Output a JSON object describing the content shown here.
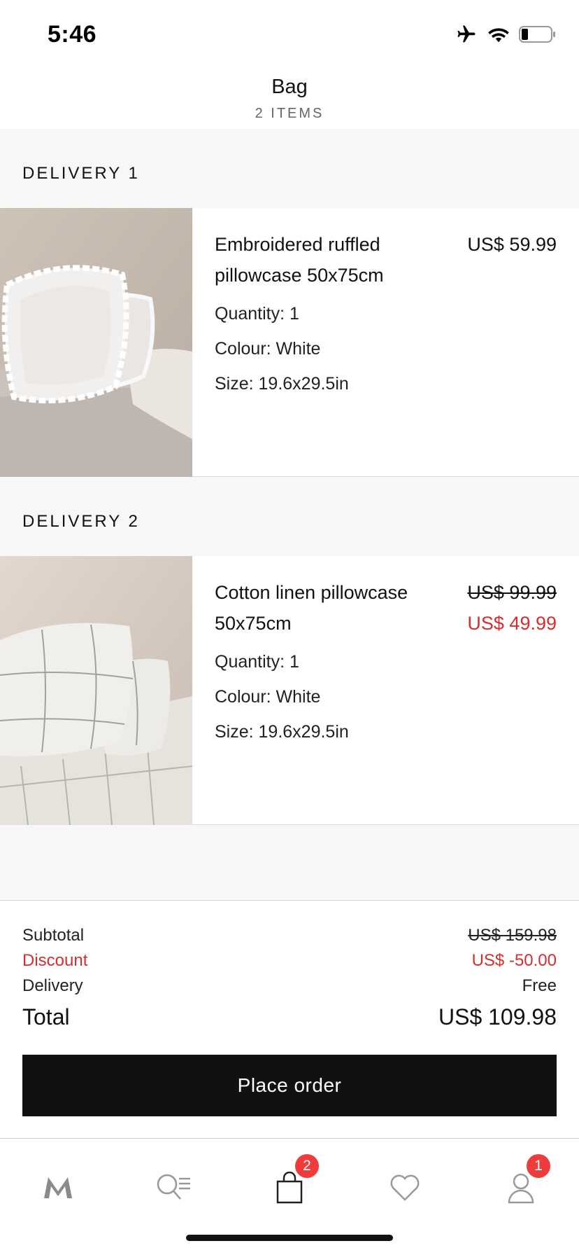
{
  "status": {
    "time": "5:46"
  },
  "header": {
    "title": "Bag",
    "count": "2 ITEMS"
  },
  "deliveries": [
    {
      "label": "DELIVERY 1",
      "item": {
        "name": "Embroidered ruffled pillowcase 50x75cm",
        "quantity": "Quantity: 1",
        "colour": "Colour: White",
        "size": "Size: 19.6x29.5in",
        "price": "US$ 59.99"
      }
    },
    {
      "label": "DELIVERY 2",
      "item": {
        "name": "Cotton linen pillowcase 50x75cm",
        "quantity": "Quantity: 1",
        "colour": "Colour: White",
        "size": "Size: 19.6x29.5in",
        "price_old": "US$ 99.99",
        "price_new": "US$ 49.99"
      }
    }
  ],
  "summary": {
    "subtotal_label": "Subtotal",
    "subtotal_value": "US$ 159.98",
    "discount_label": "Discount",
    "discount_value": "US$ -50.00",
    "delivery_label": "Delivery",
    "delivery_value": "Free",
    "total_label": "Total",
    "total_value": "US$ 109.98"
  },
  "actions": {
    "place_order": "Place order"
  },
  "tabbar": {
    "items": [
      {
        "name": "home",
        "icon": "m-logo-icon"
      },
      {
        "name": "search",
        "icon": "search-list-icon"
      },
      {
        "name": "bag",
        "icon": "bag-icon",
        "badge": "2"
      },
      {
        "name": "favourites",
        "icon": "heart-icon"
      },
      {
        "name": "account",
        "icon": "user-icon",
        "badge": "1"
      }
    ]
  },
  "colors": {
    "accent_red": "#d32f2f",
    "badge_red": "#ef3b3b",
    "button_black": "#111111"
  }
}
